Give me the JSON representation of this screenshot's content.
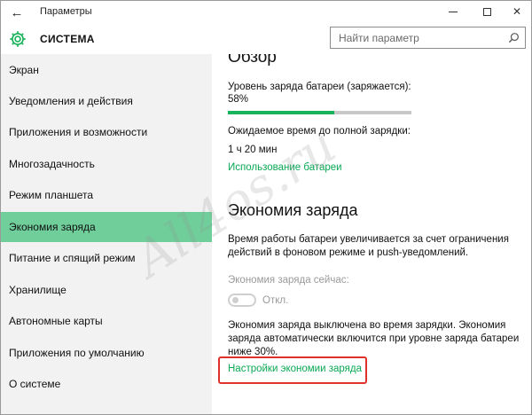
{
  "window": {
    "title": "Параметры",
    "back_glyph": "←",
    "close_glyph": "✕"
  },
  "header": {
    "title": "СИСТЕМА",
    "search_placeholder": "Найти параметр"
  },
  "sidebar": {
    "items": [
      {
        "label": "Экран"
      },
      {
        "label": "Уведомления и действия"
      },
      {
        "label": "Приложения и возможности"
      },
      {
        "label": "Многозадачность"
      },
      {
        "label": "Режим планшета"
      },
      {
        "label": "Экономия заряда",
        "active": true
      },
      {
        "label": "Питание и спящий режим"
      },
      {
        "label": "Хранилище"
      },
      {
        "label": "Автономные карты"
      },
      {
        "label": "Приложения по умолчанию"
      },
      {
        "label": "О системе"
      }
    ]
  },
  "overview": {
    "heading": "Обзор",
    "level_label": "Уровень заряда батареи (заряжается):",
    "level_value": "58%",
    "level_fraction": 0.58,
    "time_label": "Ожидаемое время до полной зарядки:",
    "time_value": "1 ч 20 мин",
    "usage_link": "Использование батареи"
  },
  "saver": {
    "heading": "Экономия заряда",
    "desc_line1": "Время работы батареи увеличивается за счет ограничения",
    "desc_line2": "действий в фоновом режиме и push-уведомлений.",
    "now_label": "Экономия заряда сейчас:",
    "toggle_label": "Откл.",
    "note_line1": "Экономия заряда выключена во время зарядки. Экономия",
    "note_line2": "заряда автоматически включится при уровне заряда батареи",
    "note_line3": "ниже 30%.",
    "settings_link": "Настройки экономии заряда"
  },
  "watermark": "All4os.ru",
  "colors": {
    "accent": "#17b35a",
    "link": "#0aa854",
    "active_nav": "#6fce9a",
    "highlight": "#e0302a"
  }
}
